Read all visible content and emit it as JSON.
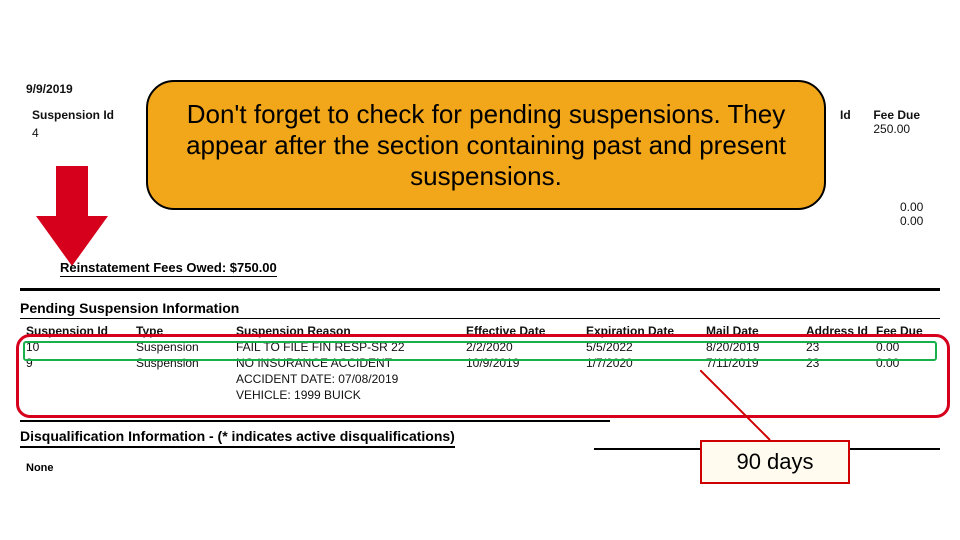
{
  "report_date": "9/9/2019",
  "top_left": {
    "suspension_id_label": "Suspension Id",
    "suspension_id_value": "4"
  },
  "top_right": {
    "id_label": "Id",
    "fee_due_label": "Fee Due",
    "fee_due_value": "250.00",
    "sub_rows": [
      "0.00",
      "0.00"
    ]
  },
  "callout": "Don't forget to check for pending suspensions. They appear after the section containing past and present suspensions.",
  "fees_owed_line": "Reinstatement Fees Owed: $750.00",
  "pending_section_title": "Pending Suspension Information",
  "table": {
    "headers": {
      "suspension_id": "Suspension Id",
      "type": "Type",
      "reason": "Suspension Reason",
      "effective": "Effective Date",
      "expiration": "Expiration Date",
      "mail": "Mail Date",
      "address_id": "Address Id",
      "fee_due": "Fee Due"
    },
    "rows": [
      {
        "suspension_id": "10",
        "type": "Suspension",
        "reason": "FAIL TO FILE FIN RESP-SR 22",
        "effective": "2/2/2020",
        "expiration": "5/5/2022",
        "mail": "8/20/2019",
        "address_id": "23",
        "fee_due": "0.00"
      },
      {
        "suspension_id": "9",
        "type": "Suspension",
        "reason": "NO INSURANCE ACCIDENT",
        "effective": "10/9/2019",
        "expiration": "1/7/2020",
        "mail": "7/11/2019",
        "address_id": "23",
        "fee_due": "0.00"
      }
    ],
    "extra_reason_lines": [
      "ACCIDENT DATE: 07/08/2019",
      "VEHICLE: 1999 BUICK"
    ]
  },
  "disq_section_title": "Disqualification Information - (* indicates active disqualifications)",
  "disq_none": "None",
  "ninety_box": "90 days"
}
